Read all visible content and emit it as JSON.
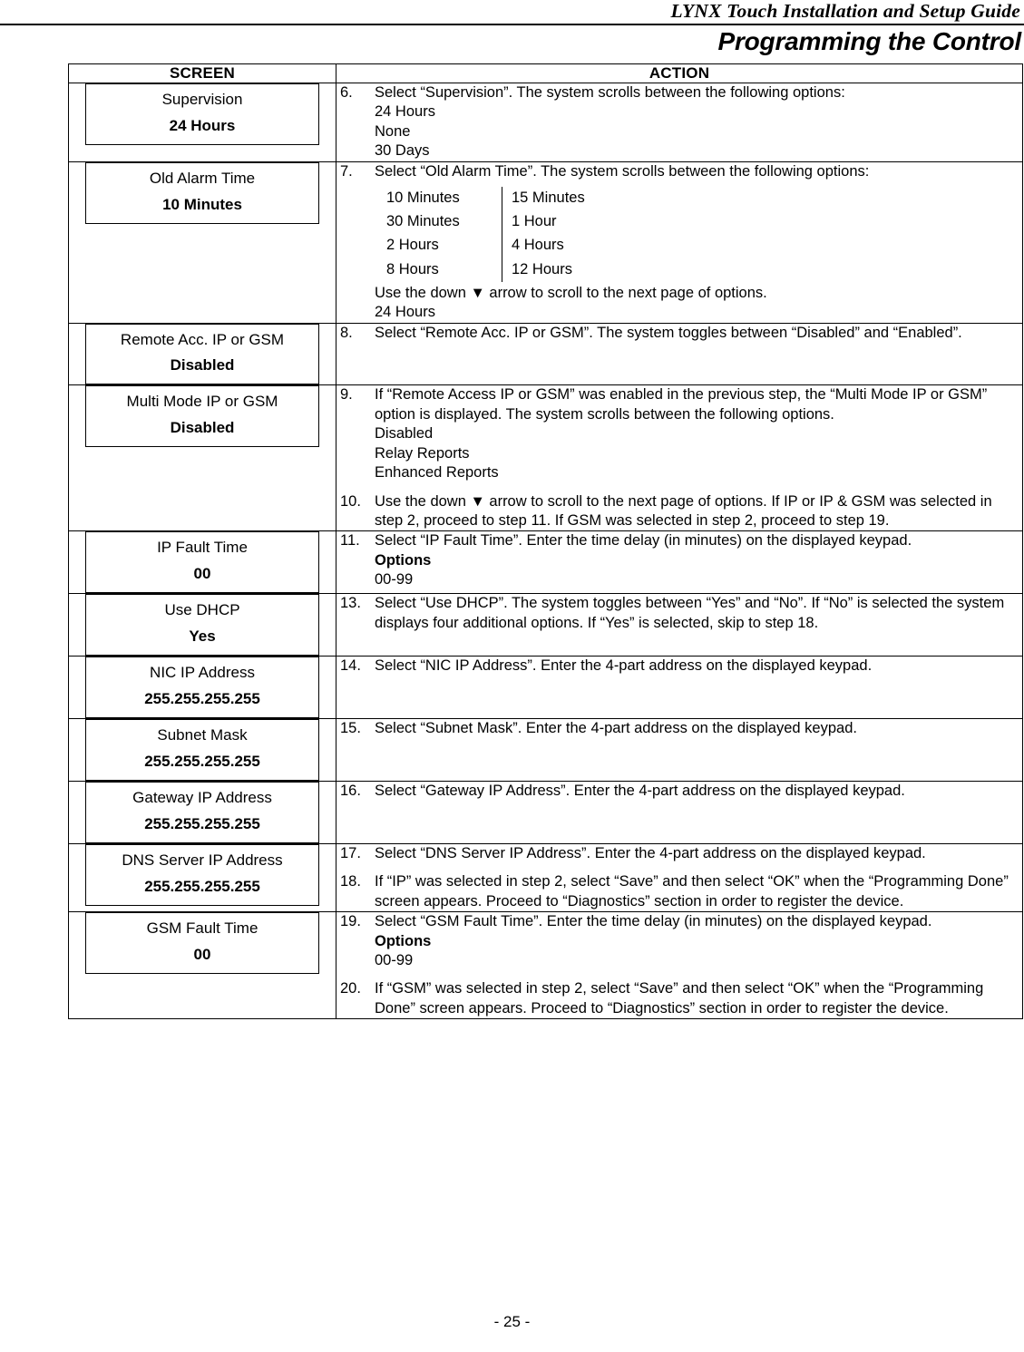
{
  "header": {
    "running_head": "LYNX Touch Installation and Setup Guide",
    "section_title": "Programming the Control"
  },
  "table": {
    "columns": {
      "screen": "SCREEN",
      "action": "ACTION"
    },
    "rows": [
      {
        "screen": {
          "title": "Supervision",
          "value": "24 Hours"
        },
        "steps": [
          {
            "num": "6.",
            "lines": [
              "Select “Supervision”. The system scrolls between the following options:",
              "24 Hours",
              "None",
              "30 Days"
            ]
          }
        ]
      },
      {
        "screen": {
          "title": "Old Alarm Time",
          "value": "10 Minutes"
        },
        "steps": [
          {
            "num": "7.",
            "lines": [
              "Select “Old Alarm Time”. The system scrolls between the following options:"
            ],
            "options_grid": {
              "left": [
                "10 Minutes",
                "30 Minutes",
                "2 Hours",
                "8 Hours"
              ],
              "right": [
                "15 Minutes",
                "1 Hour",
                "4 Hours",
                "12 Hours"
              ]
            },
            "after_lines": [
              "Use the down ▼ arrow to scroll to the next page of options.",
              "24 Hours"
            ]
          }
        ]
      },
      {
        "screen": {
          "title": "Remote Acc. IP or GSM",
          "value": "Disabled"
        },
        "steps": [
          {
            "num": "8.",
            "lines": [
              "Select “Remote Acc. IP or GSM”. The system toggles between “Disabled” and “Enabled”."
            ]
          }
        ]
      },
      {
        "screen": {
          "title": "Multi Mode IP or GSM",
          "value": "Disabled"
        },
        "steps": [
          {
            "num": "9.",
            "lines": [
              "If “Remote Access IP or GSM” was enabled in the previous step, the “Multi Mode IP or GSM” option is displayed. The system scrolls between the following options.",
              "Disabled",
              "Relay Reports",
              "Enhanced Reports"
            ]
          },
          {
            "num": "10.",
            "lines": [
              "Use the down ▼ arrow to scroll to the next page of options. If IP or IP & GSM was selected in step 2, proceed to step 11. If GSM was selected in step 2, proceed to step 19."
            ]
          }
        ]
      },
      {
        "screen": {
          "title": "IP Fault Time",
          "value": "00"
        },
        "steps": [
          {
            "num": "11.",
            "lines": [
              "Select “IP Fault Time”. Enter the time delay (in minutes) on the displayed keypad."
            ],
            "options_label": "Options",
            "options_range": "00-99"
          }
        ]
      },
      {
        "screen": {
          "title": "Use DHCP",
          "value": "Yes"
        },
        "steps": [
          {
            "num": "13.",
            "lines": [
              "Select “Use DHCP”. The system toggles between “Yes” and “No”. If “No” is selected the system displays four additional options. If “Yes” is selected, skip to step 18."
            ]
          }
        ]
      },
      {
        "screen": {
          "title": "NIC IP Address",
          "value": "255.255.255.255"
        },
        "steps": [
          {
            "num": "14.",
            "lines": [
              "Select “NIC IP Address”. Enter the 4-part address on the displayed keypad."
            ]
          }
        ]
      },
      {
        "screen": {
          "title": "Subnet Mask",
          "value": "255.255.255.255"
        },
        "steps": [
          {
            "num": "15.",
            "lines": [
              "Select “Subnet Mask”. Enter the 4-part address on the displayed keypad."
            ]
          }
        ]
      },
      {
        "screen": {
          "title": "Gateway IP Address",
          "value": "255.255.255.255"
        },
        "steps": [
          {
            "num": "16.",
            "lines": [
              "Select “Gateway IP Address”. Enter the 4-part  address on the displayed keypad."
            ]
          }
        ]
      },
      {
        "screen": {
          "title": "DNS Server IP Address",
          "value": "255.255.255.255"
        },
        "steps": [
          {
            "num": "17.",
            "lines": [
              "Select “DNS Server IP Address”. Enter the 4-part  address on the displayed keypad."
            ]
          },
          {
            "num": "18.",
            "lines": [
              "If “IP” was selected in step 2, select “Save” and then select “OK” when the “Programming Done” screen appears. Proceed to “Diagnostics” section in order to register the device."
            ]
          }
        ]
      },
      {
        "screen": {
          "title": "GSM Fault Time",
          "value": "00"
        },
        "steps": [
          {
            "num": "19.",
            "lines": [
              "Select “GSM Fault Time”. Enter the time delay (in minutes) on the displayed keypad."
            ],
            "options_label": "Options",
            "options_range": "00-99"
          },
          {
            "num": "20.",
            "lines": [
              "If “GSM” was selected in step 2, select “Save” and then select “OK” when the “Programming Done” screen appears. Proceed to “Diagnostics” section in order to register the device."
            ]
          }
        ]
      }
    ]
  },
  "footer": {
    "page_number": "- 25 -"
  }
}
